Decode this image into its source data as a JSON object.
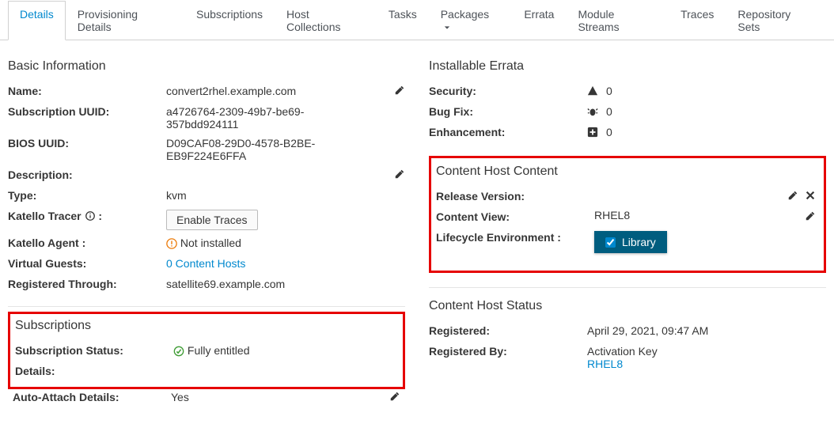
{
  "tabs": {
    "details": "Details",
    "provisioning_details": "Provisioning Details",
    "subscriptions": "Subscriptions",
    "host_collections": "Host Collections",
    "tasks": "Tasks",
    "packages": "Packages",
    "errata": "Errata",
    "module_streams": "Module Streams",
    "traces": "Traces",
    "repository_sets": "Repository Sets"
  },
  "basic_info": {
    "title": "Basic Information",
    "name_label": "Name:",
    "name_value": "convert2rhel.example.com",
    "sub_uuid_label": "Subscription UUID:",
    "sub_uuid_value": "a4726764-2309-49b7-be69-357bdd924111",
    "bios_uuid_label": "BIOS UUID:",
    "bios_uuid_value": "D09CAF08-29D0-4578-B2BE-EB9F224E6FFA",
    "description_label": "Description:",
    "description_value": "",
    "type_label": "Type:",
    "type_value": "kvm",
    "tracer_label": "Katello Tracer",
    "tracer_colon": " :",
    "tracer_button": "Enable Traces",
    "agent_label": "Katello Agent :",
    "agent_value": "Not installed",
    "guests_label": "Virtual Guests:",
    "guests_value": "0 Content Hosts",
    "registered_through_label": "Registered Through:",
    "registered_through_value": "satellite69.example.com"
  },
  "subscriptions": {
    "title": "Subscriptions",
    "status_label": "Subscription Status:",
    "status_value": "Fully entitled",
    "details_label": "Details:",
    "auto_attach_label": "Auto-Attach Details:",
    "auto_attach_value": "Yes"
  },
  "installable_errata": {
    "title": "Installable Errata",
    "security_label": "Security:",
    "security_value": "0",
    "bugfix_label": "Bug Fix:",
    "bugfix_value": "0",
    "enhancement_label": "Enhancement:",
    "enhancement_value": "0"
  },
  "content_host_content": {
    "title": "Content Host Content",
    "release_version_label": "Release Version:",
    "release_version_value": "",
    "content_view_label": "Content View:",
    "content_view_value": "RHEL8",
    "lifecycle_env_label": "Lifecycle Environment :",
    "lifecycle_env_value": "Library"
  },
  "content_host_status": {
    "title": "Content Host Status",
    "registered_label": "Registered:",
    "registered_value": "April 29, 2021, 09:47 AM",
    "registered_by_label": "Registered By:",
    "registered_by_value": "Activation Key",
    "registered_by_link": "RHEL8"
  }
}
